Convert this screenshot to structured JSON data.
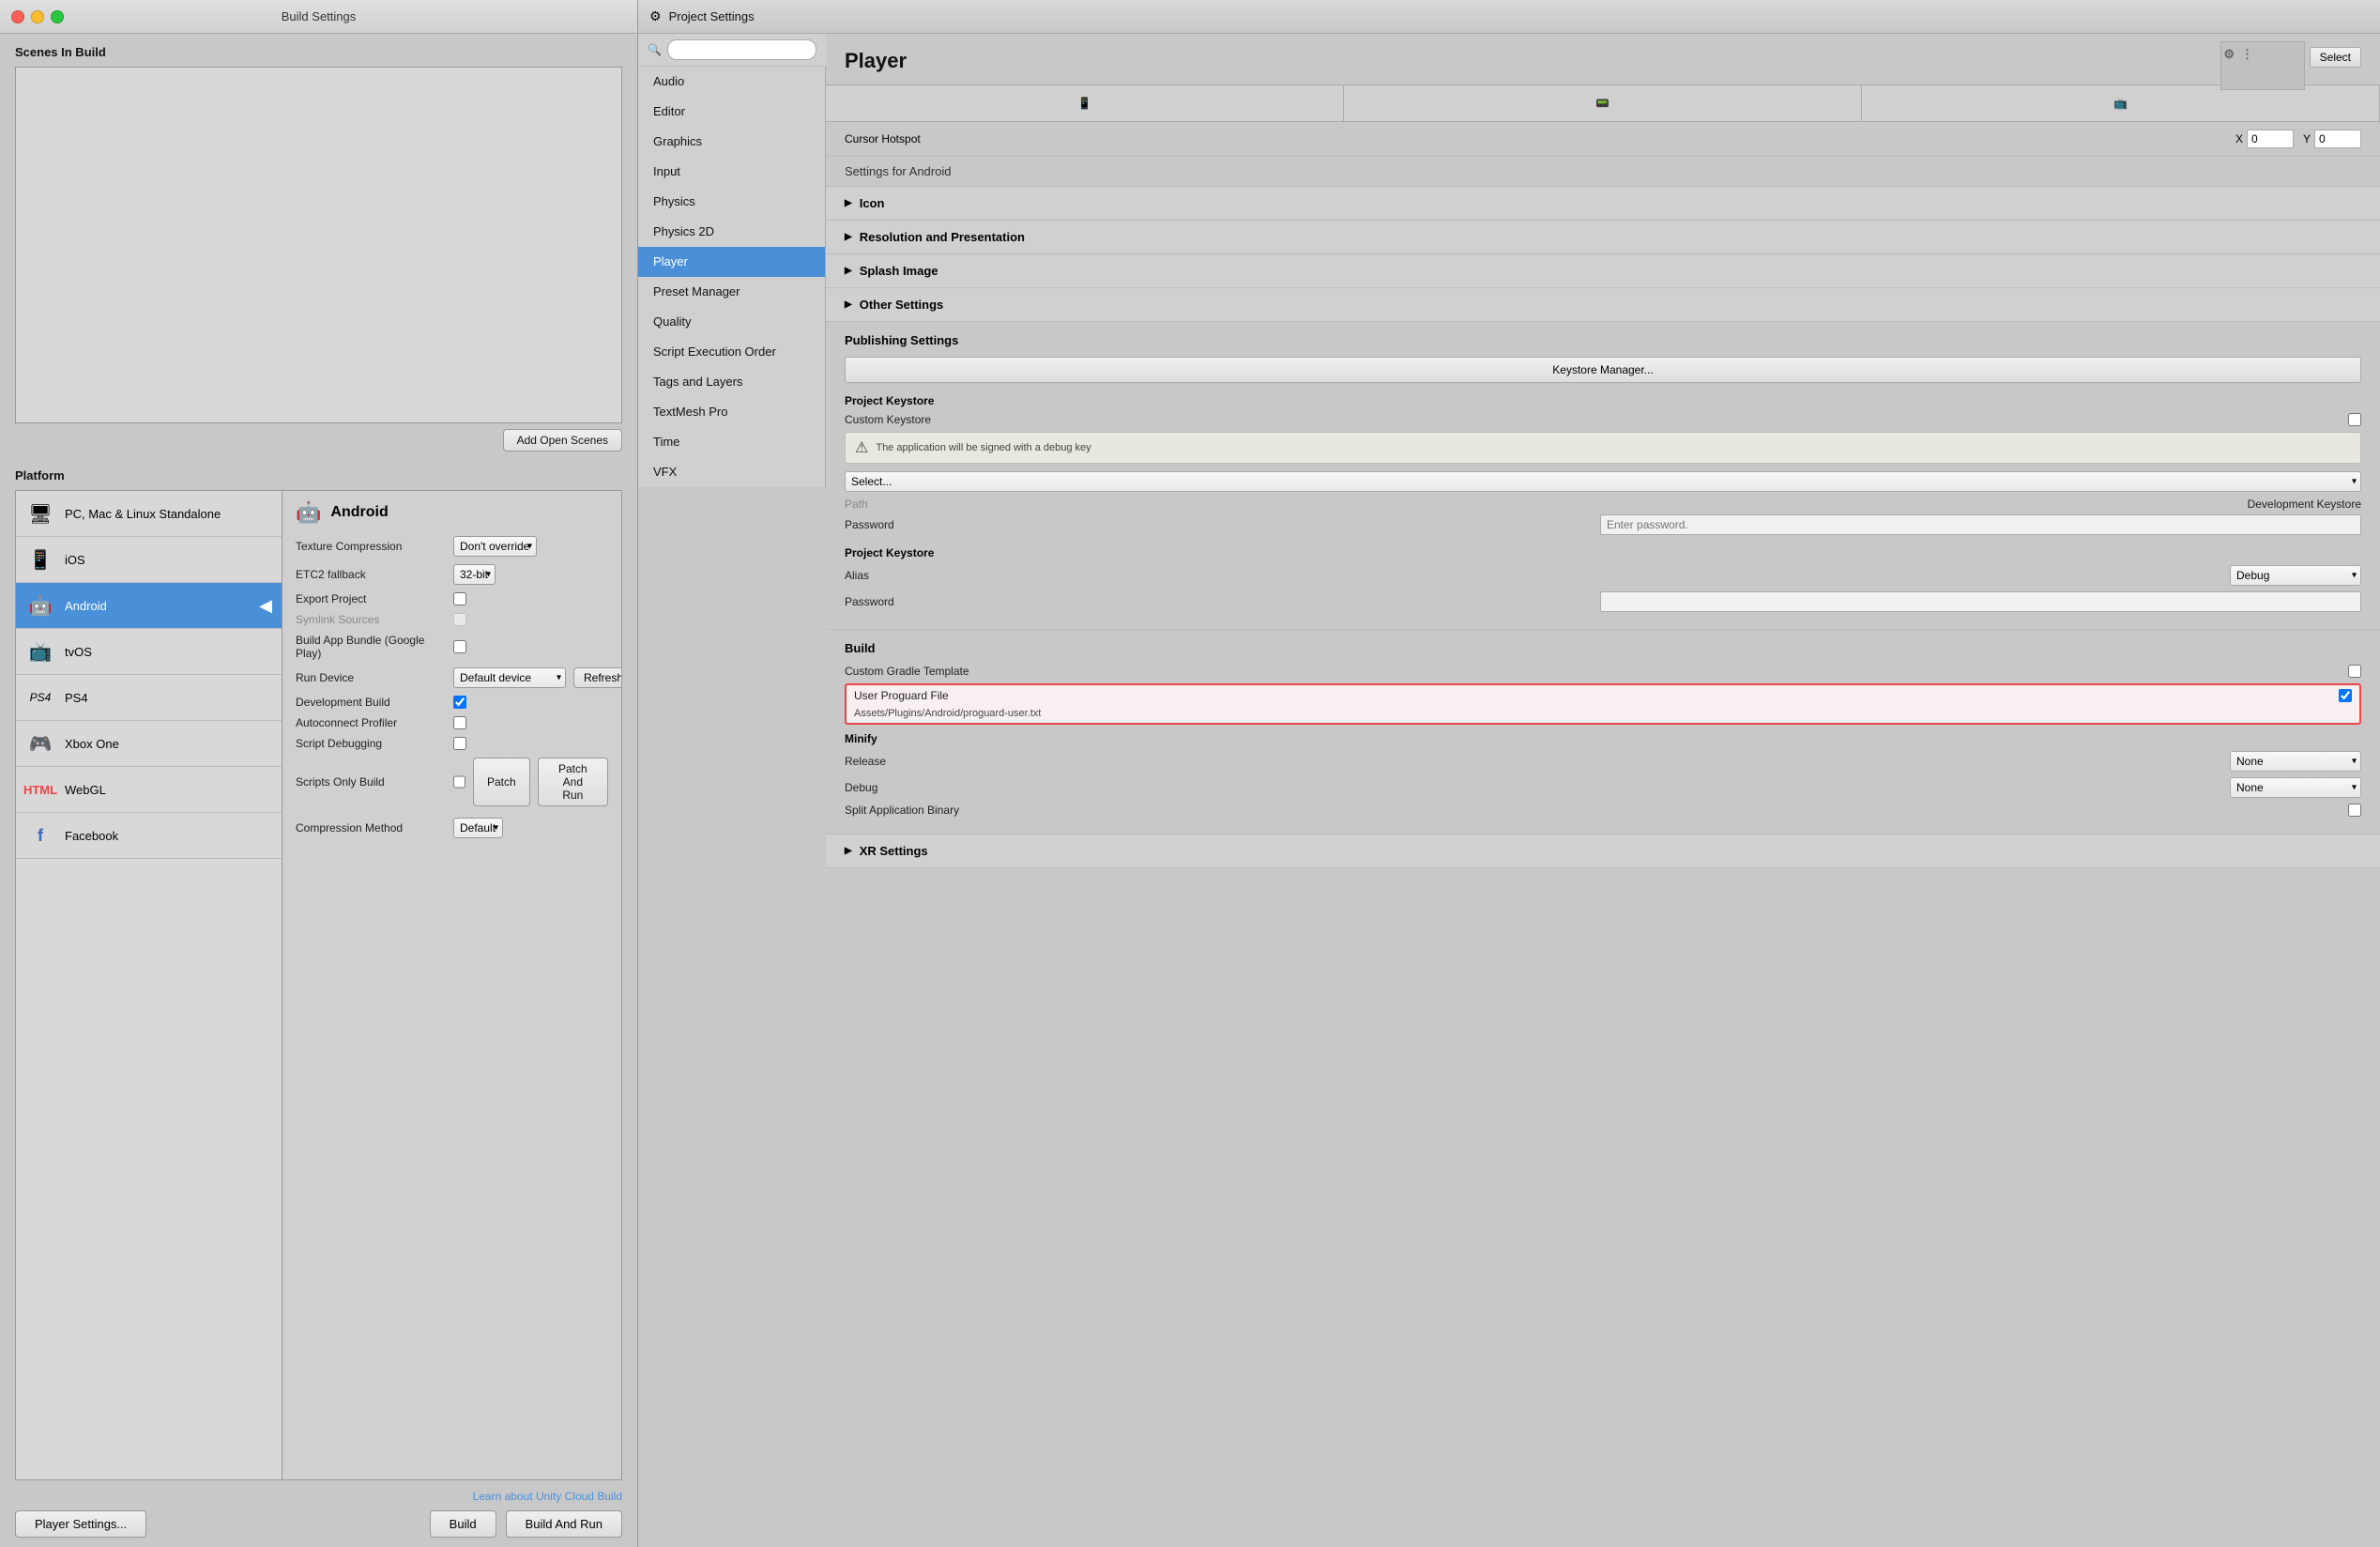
{
  "buildSettings": {
    "title": "Build Settings",
    "scenesInBuild": "Scenes In Build",
    "addOpenScenes": "Add Open Scenes",
    "platform": "Platform",
    "playerSettingsBtn": "Player Settings...",
    "buildBtn": "Build",
    "buildAndRunBtn": "Build And Run",
    "learnLink": "Learn about Unity Cloud Build",
    "platforms": [
      {
        "id": "standalone",
        "name": "PC, Mac & Linux Standalone",
        "icon": "🖥"
      },
      {
        "id": "ios",
        "name": "iOS",
        "icon": "📱"
      },
      {
        "id": "android",
        "name": "Android",
        "icon": "🤖",
        "selected": true
      },
      {
        "id": "tvos",
        "name": "tvOS",
        "icon": "📺"
      },
      {
        "id": "ps4",
        "name": "PS4",
        "icon": "🎮"
      },
      {
        "id": "xboxone",
        "name": "Xbox One",
        "icon": "🎮"
      },
      {
        "id": "webgl",
        "name": "WebGL",
        "icon": "🌐"
      },
      {
        "id": "facebook",
        "name": "Facebook",
        "icon": "📘"
      }
    ],
    "androidSettings": {
      "title": "Android",
      "textureCompression": {
        "label": "Texture Compression",
        "value": "Don't override"
      },
      "etc2Fallback": {
        "label": "ETC2 fallback",
        "value": "32-bit"
      },
      "exportProject": {
        "label": "Export Project",
        "checked": false
      },
      "symlinkSources": {
        "label": "Symlink Sources",
        "checked": false,
        "disabled": true
      },
      "buildAppBundle": {
        "label": "Build App Bundle (Google Play)",
        "checked": false
      },
      "runDevice": {
        "label": "Run Device",
        "value": "Default device",
        "refreshBtn": "Refresh"
      },
      "developmentBuild": {
        "label": "Development Build",
        "checked": true
      },
      "autoconnectProfiler": {
        "label": "Autoconnect Profiler",
        "checked": false
      },
      "scriptDebugging": {
        "label": "Script Debugging",
        "checked": false
      },
      "scriptsOnlyBuild": {
        "label": "Scripts Only Build",
        "checked": false,
        "patchBtn": "Patch",
        "patchAndRunBtn": "Patch And Run"
      },
      "compressionMethod": {
        "label": "Compression Method",
        "value": "Default"
      }
    }
  },
  "projectSettings": {
    "title": "Project Settings",
    "searchPlaceholder": "",
    "navItems": [
      "Audio",
      "Editor",
      "Graphics",
      "Input",
      "Physics",
      "Physics 2D",
      "Player",
      "Preset Manager",
      "Quality",
      "Script Execution Order",
      "Tags and Layers",
      "TextMesh Pro",
      "Time",
      "VFX"
    ],
    "selectedNav": "Player",
    "playerTitle": "Player",
    "selectBtn": "Select",
    "cursorHotspot": {
      "label": "Cursor Hotspot",
      "x": "0",
      "y": "0"
    },
    "settingsFor": "Settings for Android",
    "sections": {
      "icon": "Icon",
      "resolutionAndPresentation": "Resolution and Presentation",
      "splashImage": "Splash Image",
      "otherSettings": "Other Settings"
    },
    "publishingSettings": {
      "title": "Publishing Settings",
      "keystoreManagerBtn": "Keystore Manager...",
      "projectKeystore": "Project Keystore",
      "customKeystore": "Custom Keystore",
      "customKeystoreChecked": false,
      "warningText": "The application will be signed with a debug key",
      "selectPlaceholder": "Select...",
      "path": "Path",
      "pathValue": "Development Keystore",
      "password": "Password",
      "passwordPlaceholder": "Enter password.",
      "projectKey": "Project Key",
      "alias": "Alias",
      "aliasValue": "Debug",
      "keyPassword": "Password",
      "build": "Build",
      "customGradleTemplate": "Custom Gradle Template",
      "customGradleChecked": false,
      "userProguardFile": "User Proguard File",
      "userProguardChecked": true,
      "proguardPath": "Assets/Plugins/Android/proguard-user.txt",
      "minify": "Minify",
      "release": "Release",
      "releaseValue": "None",
      "debug": "Debug",
      "debugValue": "None",
      "splitAppBinary": "Split Application Binary",
      "splitAppBinaryChecked": false
    },
    "xrSettings": "XR Settings"
  }
}
